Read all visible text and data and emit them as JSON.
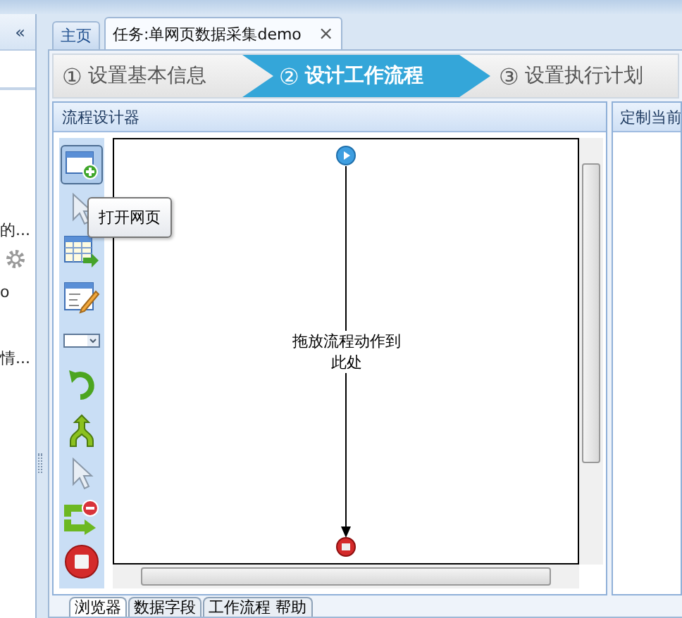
{
  "sidebar": {
    "collapse_button": "«",
    "items": [
      {
        "text": "的..."
      },
      {
        "text": "o"
      },
      {
        "text": "情..."
      }
    ]
  },
  "tabs": [
    {
      "label": "主页",
      "selected": false
    },
    {
      "label": "任务:单网页数据采集demo",
      "selected": true,
      "close": "×"
    }
  ],
  "steps": [
    {
      "number": "①",
      "label": "设置基本信息",
      "selected": false
    },
    {
      "number": "②",
      "label": "设计工作流程",
      "selected": true
    },
    {
      "number": "③",
      "label": "设置执行计划",
      "selected": false
    }
  ],
  "designer": {
    "title": "流程设计器",
    "tools": [
      {
        "kind": "page",
        "selected": true
      },
      {
        "kind": "pointer",
        "selected": false
      },
      {
        "kind": "table",
        "selected": false
      },
      {
        "kind": "form",
        "selected": false
      },
      {
        "kind": "dropdown",
        "selected": false
      },
      {
        "kind": "loop",
        "selected": false
      },
      {
        "kind": "branch",
        "selected": false
      },
      {
        "kind": "pointer",
        "selected": false
      },
      {
        "kind": "repeat",
        "selected": false
      },
      {
        "kind": "stop",
        "selected": false
      }
    ],
    "tooltip": "打开网页",
    "hint": "拖放流程动作到此处"
  },
  "side_panel": {
    "title": "定制当前"
  },
  "bottom_tabs": [
    {
      "label": "浏览器",
      "selected": true
    },
    {
      "label": "数据字段",
      "selected": false
    },
    {
      "label": "工作流程 帮助",
      "selected": false
    }
  ]
}
